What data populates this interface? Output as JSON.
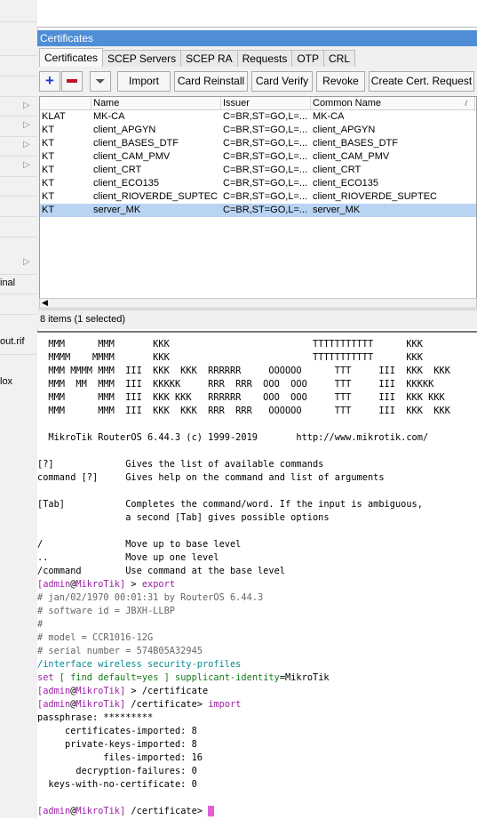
{
  "leftnav": {
    "labels": [
      "inal",
      "out.rif",
      "lox"
    ]
  },
  "window": {
    "title": "Certificates",
    "tabs": [
      "Certificates",
      "SCEP Servers",
      "SCEP RA",
      "Requests",
      "OTP",
      "CRL"
    ],
    "toolbar": {
      "import": "Import",
      "card_reinstall": "Card Reinstall",
      "card_verify": "Card Verify",
      "revoke": "Revoke",
      "create_request": "Create Cert. Request"
    },
    "columns": [
      "",
      "Name",
      "Issuer",
      "Common Name"
    ],
    "rows": [
      {
        "flags": "KLAT",
        "name": "MK-CA",
        "issuer": "C=BR,ST=GO,L=...",
        "common": "MK-CA"
      },
      {
        "flags": "KT",
        "name": "client_APGYN",
        "issuer": "C=BR,ST=GO,L=...",
        "common": "client_APGYN"
      },
      {
        "flags": "KT",
        "name": "client_BASES_DTF",
        "issuer": "C=BR,ST=GO,L=...",
        "common": "client_BASES_DTF"
      },
      {
        "flags": "KT",
        "name": "client_CAM_PMV",
        "issuer": "C=BR,ST=GO,L=...",
        "common": "client_CAM_PMV"
      },
      {
        "flags": "KT",
        "name": "client_CRT",
        "issuer": "C=BR,ST=GO,L=...",
        "common": "client_CRT"
      },
      {
        "flags": "KT",
        "name": "client_ECO135",
        "issuer": "C=BR,ST=GO,L=...",
        "common": "client_ECO135"
      },
      {
        "flags": "KT",
        "name": "client_RIOVERDE_SUPTEC",
        "issuer": "C=BR,ST=GO,L=...",
        "common": "client_RIOVERDE_SUPTEC"
      },
      {
        "flags": "KT",
        "name": "server_MK",
        "issuer": "C=BR,ST=GO,L=...",
        "common": "server_MK"
      }
    ],
    "selected_row": 7,
    "status": "8 items (1 selected)"
  },
  "terminal": {
    "banner": [
      "  MMM      MMM       KKK                          TTTTTTTTTTT      KKK",
      "  MMMM    MMMM       KKK                          TTTTTTTTTTT      KKK",
      "  MMM MMMM MMM  III  KKK  KKK  RRRRRR     OOOOOO      TTT     III  KKK  KKK",
      "  MMM  MM  MMM  III  KKKKK     RRR  RRR  OOO  OOO     TTT     III  KKKKK",
      "  MMM      MMM  III  KKK KKK   RRRRRR    OOO  OOO     TTT     III  KKK KKK",
      "  MMM      MMM  III  KKK  KKK  RRR  RRR   OOOOOO      TTT     III  KKK  KKK"
    ],
    "version_line": "  MikroTik RouterOS 6.44.3 (c) 1999-2019       http://www.mikrotik.com/",
    "help": [
      "[?]             Gives the list of available commands",
      "command [?]     Gives help on the command and list of arguments",
      "",
      "[Tab]           Completes the command/word. If the input is ambiguous,",
      "                a second [Tab] gives possible options",
      "",
      "/               Move up to base level",
      "..              Move up one level",
      "/command        Use command at the base level"
    ],
    "prompt_user": "admin",
    "prompt_host": "MikroTik",
    "cmd_export": "export",
    "export_output": [
      "# jan/02/1970 00:01:31 by RouterOS 6.44.3",
      "# software id = JBXH-LLBP",
      "#",
      "# model = CCR1016-12G",
      "# serial number = 574B05A32945"
    ],
    "iface_line": "/interface wireless security-profiles",
    "set_word": "set",
    "find_part": " [ find ",
    "default_key": "default",
    "default_val": "=yes ] ",
    "supplicant_key": "supplicant-identity",
    "supplicant_val": "=MikroTik",
    "cert_path": "/certificate",
    "cmd_import": "import",
    "passphrase": "passphrase: *********",
    "import_results": [
      "     certificates-imported: 8",
      "     private-keys-imported: 8",
      "            files-imported: 16",
      "       decryption-failures: 0",
      "  keys-with-no-certificate: 0"
    ]
  }
}
